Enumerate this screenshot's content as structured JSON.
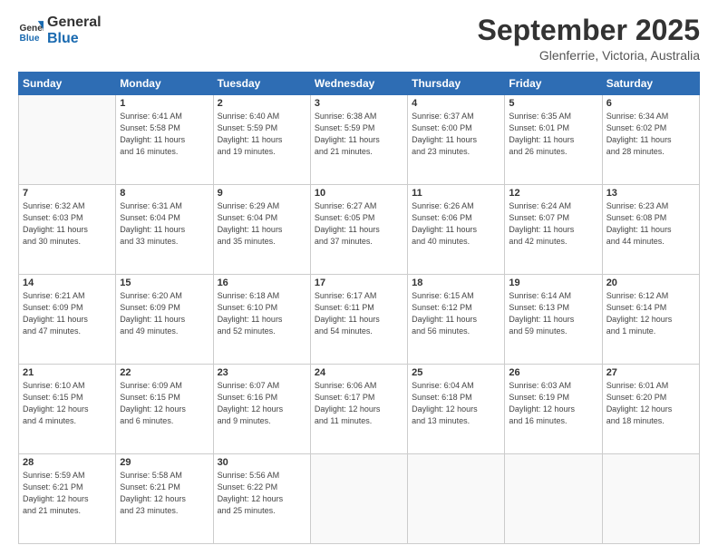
{
  "logo": {
    "line1": "General",
    "line2": "Blue"
  },
  "header": {
    "month": "September 2025",
    "location": "Glenferrie, Victoria, Australia"
  },
  "days_of_week": [
    "Sunday",
    "Monday",
    "Tuesday",
    "Wednesday",
    "Thursday",
    "Friday",
    "Saturday"
  ],
  "weeks": [
    [
      {
        "day": "",
        "info": ""
      },
      {
        "day": "1",
        "info": "Sunrise: 6:41 AM\nSunset: 5:58 PM\nDaylight: 11 hours\nand 16 minutes."
      },
      {
        "day": "2",
        "info": "Sunrise: 6:40 AM\nSunset: 5:59 PM\nDaylight: 11 hours\nand 19 minutes."
      },
      {
        "day": "3",
        "info": "Sunrise: 6:38 AM\nSunset: 5:59 PM\nDaylight: 11 hours\nand 21 minutes."
      },
      {
        "day": "4",
        "info": "Sunrise: 6:37 AM\nSunset: 6:00 PM\nDaylight: 11 hours\nand 23 minutes."
      },
      {
        "day": "5",
        "info": "Sunrise: 6:35 AM\nSunset: 6:01 PM\nDaylight: 11 hours\nand 26 minutes."
      },
      {
        "day": "6",
        "info": "Sunrise: 6:34 AM\nSunset: 6:02 PM\nDaylight: 11 hours\nand 28 minutes."
      }
    ],
    [
      {
        "day": "7",
        "info": "Sunrise: 6:32 AM\nSunset: 6:03 PM\nDaylight: 11 hours\nand 30 minutes."
      },
      {
        "day": "8",
        "info": "Sunrise: 6:31 AM\nSunset: 6:04 PM\nDaylight: 11 hours\nand 33 minutes."
      },
      {
        "day": "9",
        "info": "Sunrise: 6:29 AM\nSunset: 6:04 PM\nDaylight: 11 hours\nand 35 minutes."
      },
      {
        "day": "10",
        "info": "Sunrise: 6:27 AM\nSunset: 6:05 PM\nDaylight: 11 hours\nand 37 minutes."
      },
      {
        "day": "11",
        "info": "Sunrise: 6:26 AM\nSunset: 6:06 PM\nDaylight: 11 hours\nand 40 minutes."
      },
      {
        "day": "12",
        "info": "Sunrise: 6:24 AM\nSunset: 6:07 PM\nDaylight: 11 hours\nand 42 minutes."
      },
      {
        "day": "13",
        "info": "Sunrise: 6:23 AM\nSunset: 6:08 PM\nDaylight: 11 hours\nand 44 minutes."
      }
    ],
    [
      {
        "day": "14",
        "info": "Sunrise: 6:21 AM\nSunset: 6:09 PM\nDaylight: 11 hours\nand 47 minutes."
      },
      {
        "day": "15",
        "info": "Sunrise: 6:20 AM\nSunset: 6:09 PM\nDaylight: 11 hours\nand 49 minutes."
      },
      {
        "day": "16",
        "info": "Sunrise: 6:18 AM\nSunset: 6:10 PM\nDaylight: 11 hours\nand 52 minutes."
      },
      {
        "day": "17",
        "info": "Sunrise: 6:17 AM\nSunset: 6:11 PM\nDaylight: 11 hours\nand 54 minutes."
      },
      {
        "day": "18",
        "info": "Sunrise: 6:15 AM\nSunset: 6:12 PM\nDaylight: 11 hours\nand 56 minutes."
      },
      {
        "day": "19",
        "info": "Sunrise: 6:14 AM\nSunset: 6:13 PM\nDaylight: 11 hours\nand 59 minutes."
      },
      {
        "day": "20",
        "info": "Sunrise: 6:12 AM\nSunset: 6:14 PM\nDaylight: 12 hours\nand 1 minute."
      }
    ],
    [
      {
        "day": "21",
        "info": "Sunrise: 6:10 AM\nSunset: 6:15 PM\nDaylight: 12 hours\nand 4 minutes."
      },
      {
        "day": "22",
        "info": "Sunrise: 6:09 AM\nSunset: 6:15 PM\nDaylight: 12 hours\nand 6 minutes."
      },
      {
        "day": "23",
        "info": "Sunrise: 6:07 AM\nSunset: 6:16 PM\nDaylight: 12 hours\nand 9 minutes."
      },
      {
        "day": "24",
        "info": "Sunrise: 6:06 AM\nSunset: 6:17 PM\nDaylight: 12 hours\nand 11 minutes."
      },
      {
        "day": "25",
        "info": "Sunrise: 6:04 AM\nSunset: 6:18 PM\nDaylight: 12 hours\nand 13 minutes."
      },
      {
        "day": "26",
        "info": "Sunrise: 6:03 AM\nSunset: 6:19 PM\nDaylight: 12 hours\nand 16 minutes."
      },
      {
        "day": "27",
        "info": "Sunrise: 6:01 AM\nSunset: 6:20 PM\nDaylight: 12 hours\nand 18 minutes."
      }
    ],
    [
      {
        "day": "28",
        "info": "Sunrise: 5:59 AM\nSunset: 6:21 PM\nDaylight: 12 hours\nand 21 minutes."
      },
      {
        "day": "29",
        "info": "Sunrise: 5:58 AM\nSunset: 6:21 PM\nDaylight: 12 hours\nand 23 minutes."
      },
      {
        "day": "30",
        "info": "Sunrise: 5:56 AM\nSunset: 6:22 PM\nDaylight: 12 hours\nand 25 minutes."
      },
      {
        "day": "",
        "info": ""
      },
      {
        "day": "",
        "info": ""
      },
      {
        "day": "",
        "info": ""
      },
      {
        "day": "",
        "info": ""
      }
    ]
  ]
}
